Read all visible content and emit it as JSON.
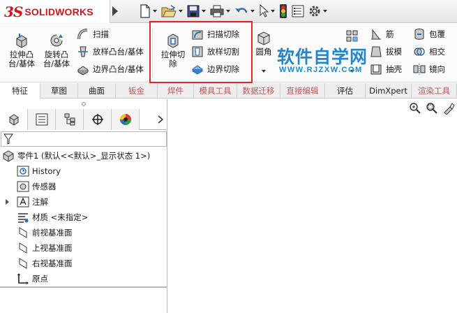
{
  "app": {
    "logo_ds": "3S",
    "logo_text": "SOLIDWORKS"
  },
  "quick_access": [
    "new-icon",
    "open-icon",
    "save-icon",
    "print-icon",
    "undo-icon",
    "select-icon",
    "rebuild-icon",
    "file-properties-icon",
    "options-icon"
  ],
  "ribbon": {
    "extrude_boss": "拉伸凸\n台/基体",
    "revolve_boss": "旋转凸\n台/基体",
    "sweep": "扫描",
    "loft_boss": "放样凸台/基体",
    "boundary_boss": "边界凸台/基体",
    "extrude_cut": "拉伸切\n除",
    "swept_cut": "扫描切除",
    "lofted_cut": "放样切割",
    "boundary_cut": "边界切除",
    "fillet": "圆角",
    "rib": "筋",
    "draft": "拔模",
    "shell": "抽壳",
    "wrap": "包覆",
    "intersect": "相交",
    "mirror": "镜向"
  },
  "watermark": {
    "main": "软件自学网",
    "sub": "WWW.RJZXW.COM"
  },
  "tabs": [
    {
      "label": "特征",
      "active": true
    },
    {
      "label": "草图"
    },
    {
      "label": "曲面"
    },
    {
      "label": "钣金"
    },
    {
      "label": "焊件"
    },
    {
      "label": "模具工具"
    },
    {
      "label": "数据迁移"
    },
    {
      "label": "直接编辑"
    },
    {
      "label": "评估"
    },
    {
      "label": "DimXpert"
    },
    {
      "label": "渲染工具"
    }
  ],
  "tree": {
    "root": "零件1  (默认<<默认>_显示状态 1>)",
    "history": "History",
    "sensors": "传感器",
    "annotations": "注解",
    "material": "材质 <未指定>",
    "front_plane": "前视基准面",
    "top_plane": "上视基准面",
    "right_plane": "右视基准面",
    "origin": "原点"
  },
  "colors": {
    "brand": "#d7141a",
    "highlight_box": "#e3262b",
    "watermark": "#1f86cf"
  }
}
